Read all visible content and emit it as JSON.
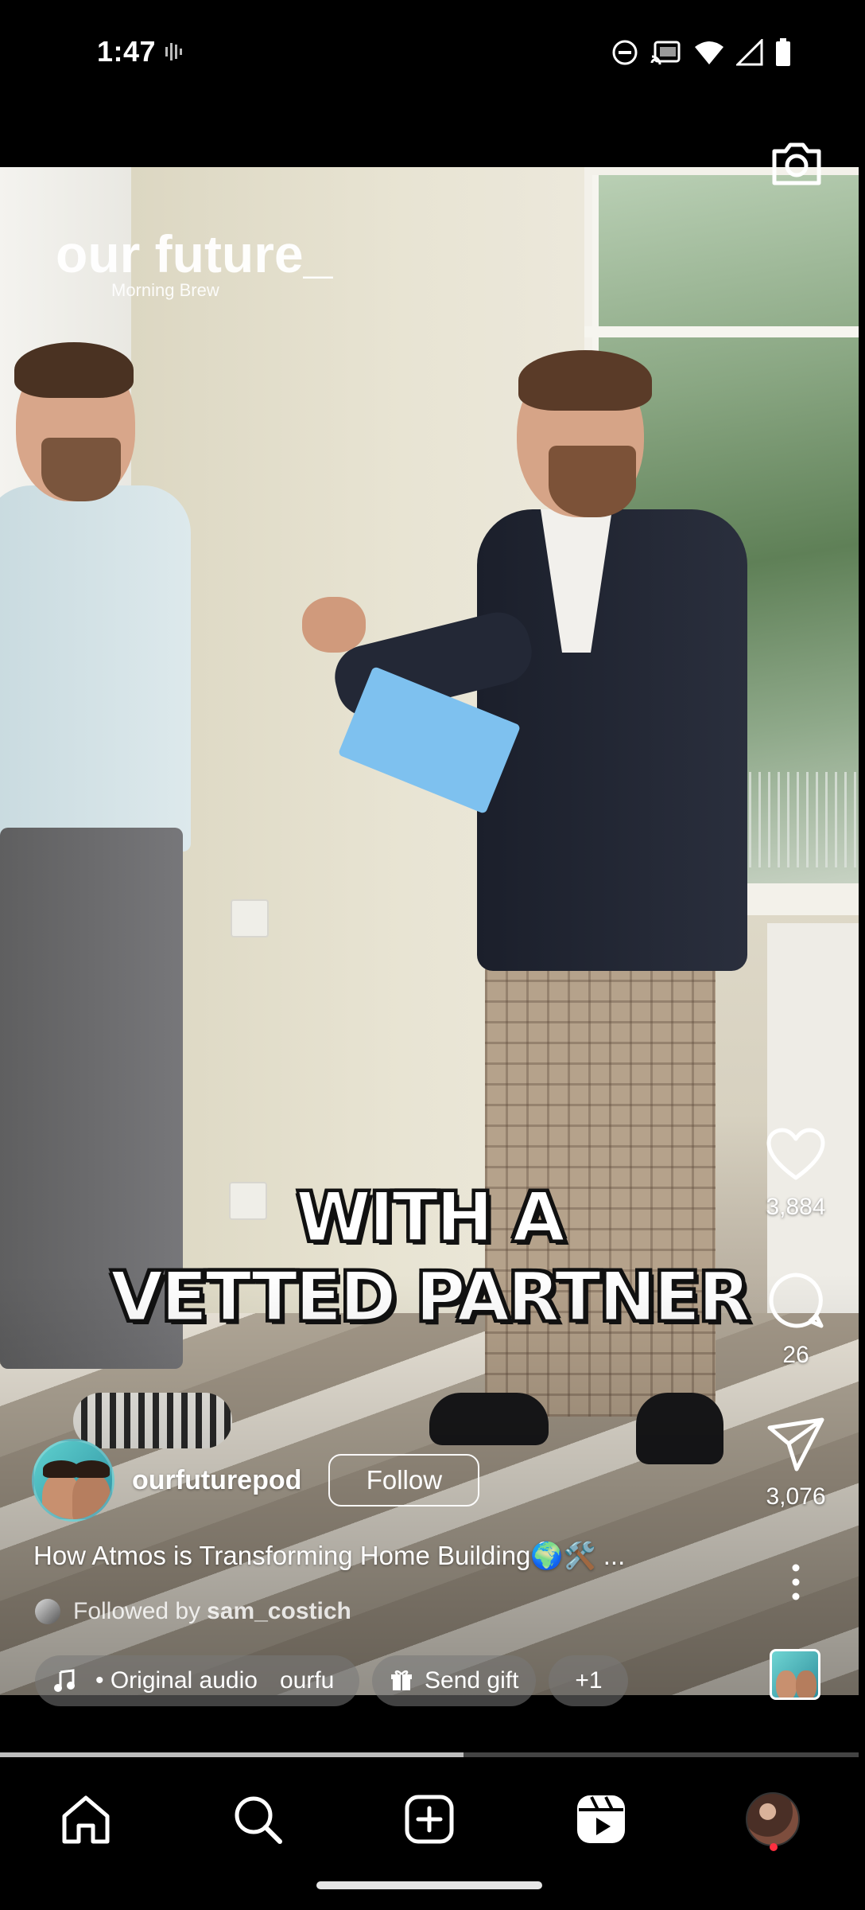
{
  "status_bar": {
    "time": "1:47",
    "icons": [
      "vibrate-icon",
      "do-not-disturb-icon",
      "cast-icon",
      "wifi-icon",
      "cellular-signal-icon",
      "battery-icon"
    ]
  },
  "video": {
    "watermark_line1": "our future_",
    "watermark_line2": "Morning Brew",
    "caption_line1": "WITH A",
    "caption_line2": "VETTED PARTNER"
  },
  "actions": {
    "likes": "3,884",
    "comments": "26",
    "shares": "3,076"
  },
  "author": {
    "username": "ourfuturepod",
    "follow_label": "Follow"
  },
  "post": {
    "caption": "How Atmos is Transforming Home Building🌍🛠️ ...",
    "followed_by_prefix": "Followed by",
    "followed_by_user": "sam_costich"
  },
  "chips": {
    "audio_label": "• Original audio",
    "audio_user": "ourfu",
    "gift_label": "Send gift",
    "more_label": "+1"
  },
  "playback": {
    "progress": 0.54
  },
  "nav": {
    "items": [
      "home-icon",
      "search-icon",
      "create-icon",
      "reels-icon",
      "profile-avatar"
    ]
  },
  "colors": {
    "background": "#000000",
    "notification": "#ff3040",
    "text": "#ffffff"
  }
}
